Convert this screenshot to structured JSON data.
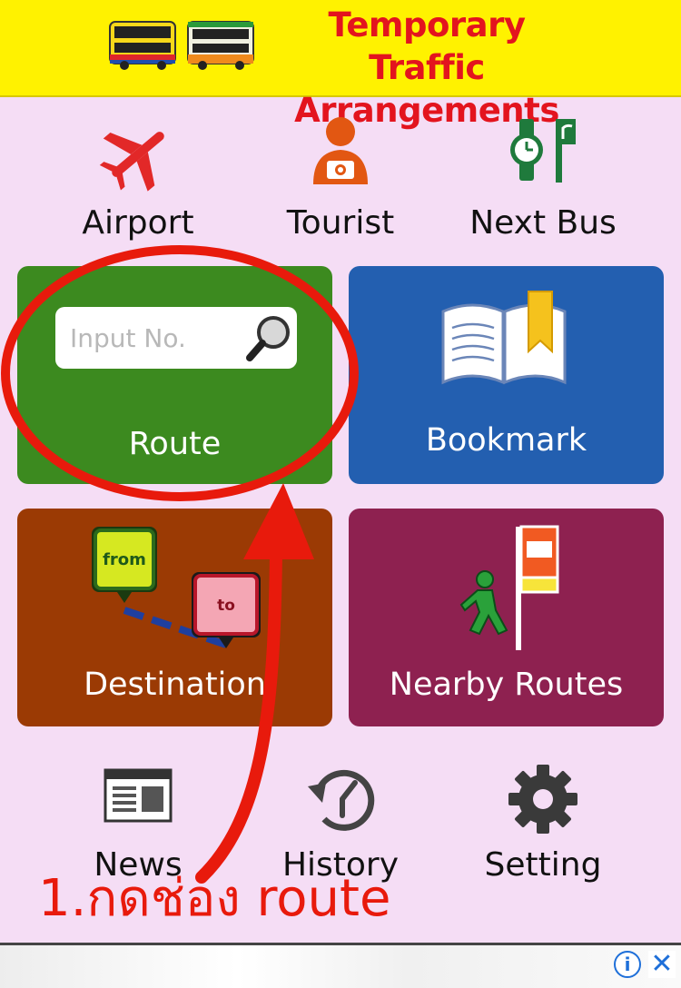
{
  "banner": {
    "title_line1": "Temporary Traffic",
    "title_line2": "Arrangements"
  },
  "top_row": [
    {
      "label": "Airport",
      "icon": "airplane-icon"
    },
    {
      "label": "Tourist",
      "icon": "tourist-camera-icon"
    },
    {
      "label": "Next Bus",
      "icon": "watch-bus-stop-icon"
    }
  ],
  "tiles": {
    "route": {
      "label": "Route",
      "placeholder": "Input No.",
      "color": "#3c8a1f"
    },
    "bookmark": {
      "label": "Bookmark",
      "color": "#235fb0"
    },
    "destination": {
      "label": "Destination",
      "from_tag": "from",
      "to_tag": "to",
      "color": "#9b3a04"
    },
    "nearby": {
      "label": "Nearby Routes",
      "color": "#8e2150"
    }
  },
  "bottom_row": [
    {
      "label": "News",
      "icon": "newspaper-icon"
    },
    {
      "label": "History",
      "icon": "history-icon"
    },
    {
      "label": "Setting",
      "icon": "gear-icon"
    }
  ],
  "annotation": {
    "text": "1.กดช่อง route",
    "color": "#e81a0c"
  },
  "ad": {
    "info_glyph": "i",
    "close_glyph": "✕"
  }
}
